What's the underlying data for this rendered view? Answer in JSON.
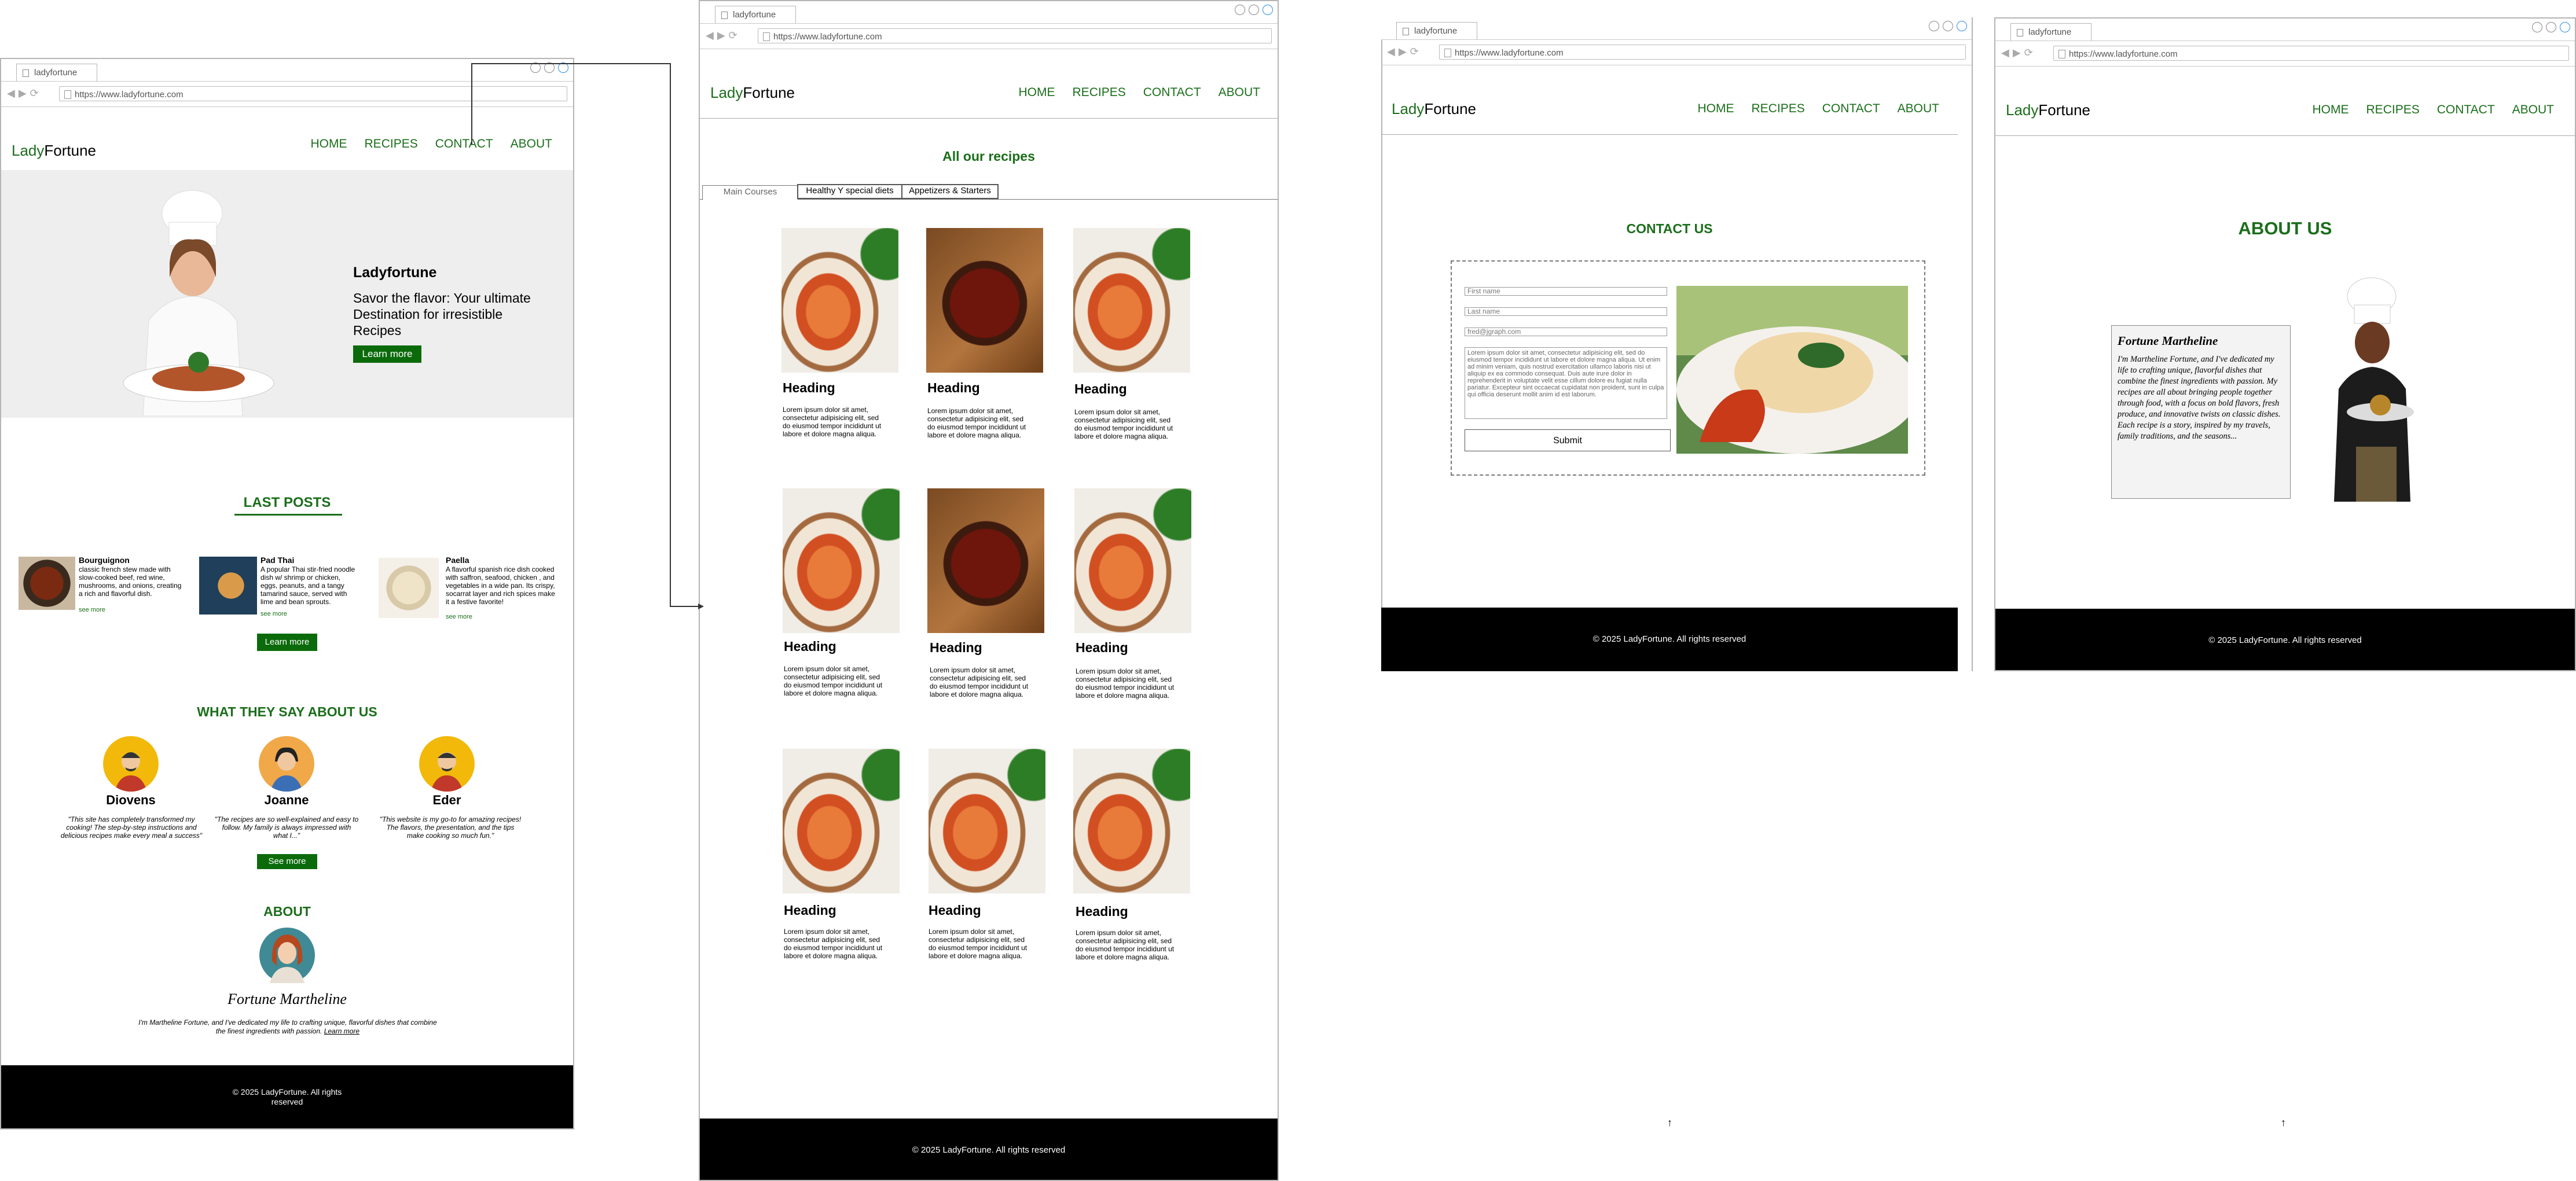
{
  "browser": {
    "tab_title": "ladyfortune",
    "url": "https://www.ladyfortune.com"
  },
  "brand": {
    "lady": "Lady",
    "fortune": "Fortune"
  },
  "nav": [
    "HOME",
    "RECIPES",
    "CONTACT",
    "ABOUT"
  ],
  "home": {
    "hero_title": "Ladyfortune",
    "hero_text": "Savor the flavor: Your ultimate Destination for irresistible Recipes",
    "learn_more": "Learn more",
    "last_posts_title": "LAST POSTS",
    "posts": [
      {
        "title": "Bourguignon",
        "text": "classic french stew made with slow-cooked beef, red wine, mushrooms, and onions, creating a rich and flavorful dish.",
        "link": "see more"
      },
      {
        "title": "Pad Thai",
        "text": "A popular Thai stir-fried noodle dish w/ shrimp or chicken, eggs, peanuts, and a tangy tamarind sauce, served with lime and bean sprouts.",
        "link": "see more"
      },
      {
        "title": "Paella",
        "text": "A flavorful spanish rice dish cooked with saffron, seafood, chicken , and vegetables in a wide pan. Its crispy, socarrat layer and rich spices make it a festive favorite!",
        "link": "see more"
      }
    ],
    "posts_button": "Learn more",
    "testimonials_title": "WHAT THEY SAY ABOUT US",
    "testimonials": [
      {
        "name": "Diovens",
        "quote": "\"This site has completely transformed my cooking! The step-by-step instructions and delicious recipes make every meal a success\""
      },
      {
        "name": "Joanne",
        "quote": "\"The recipes are so well-explained and easy to follow. My family is always impressed with what I...\""
      },
      {
        "name": "Eder",
        "quote": "\"This website is my go-to for amazing recipes! The flavors, the presentation, and the tips make cooking so much fun.\""
      }
    ],
    "see_more": "See more",
    "about_title": "ABOUT",
    "about_name": "Fortune Martheline",
    "about_text": "I'm Martheline Fortune, and I've dedicated my life to crafting unique, flavorful dishes that combine the finest ingredients with passion.",
    "about_link": "Learn more",
    "footer": "© 2025 LadyFortune. All rights reserved"
  },
  "recipes": {
    "title": "All our recipes",
    "tabs": [
      "Main Courses",
      "Healthy Y special diets",
      "Appetizers & Starters"
    ],
    "card_heading": "Heading",
    "card_text": "Lorem ipsum dolor sit amet, consectetur adipisicing elit, sed do eiusmod tempor incididunt ut labore et dolore magna aliqua.",
    "footer": "© 2025 LadyFortune. All rights reserved"
  },
  "contact": {
    "title": "CONTACT US",
    "placeholders": [
      "First name",
      "Last name",
      "fred@jgraph.com"
    ],
    "message": "Lorem ipsum dolor sit amet, consectetur adipisicing elit, sed do eiusmod tempor incididunt ut labore et dolore magna aliqua. Ut enim ad minim veniam, quis nostrud exercitation ullamco laboris nisi ut aliquip ex ea commodo consequat. Duis aute irure dolor in reprehenderit in voluptate velit esse cillum dolore eu fugiat nulla pariatur. Excepteur sint occaecat cupidatat non proident, sunt in culpa qui officia deserunt mollit anim id est laborum.",
    "submit": "Submit",
    "footer": "© 2025 LadyFortune. All rights reserved"
  },
  "about": {
    "title": "ABOUT US",
    "name": "Fortune Martheline",
    "bio": "I'm Martheline Fortune, and I've dedicated my life to crafting unique, flavorful dishes that combine the finest ingredients with passion. My recipes are all about bringing people together through food, with a focus on bold flavors, fresh produce, and innovative twists on classic dishes. Each recipe is a story, inspired by my travels, family traditions, and the seasons...",
    "footer": "© 2025 LadyFortune. All rights reserved"
  }
}
